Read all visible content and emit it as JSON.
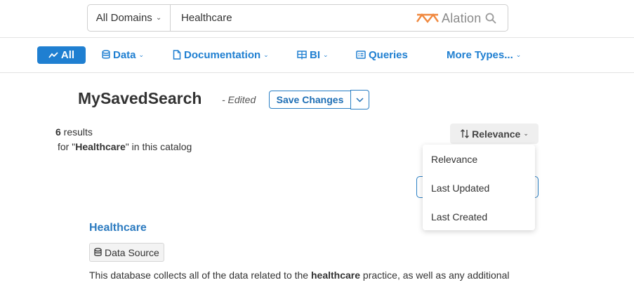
{
  "search": {
    "domain_label": "All Domains",
    "query": "Healthcare",
    "brand_name": "Alation"
  },
  "nav": {
    "all": "All",
    "data": "Data",
    "documentation": "Documentation",
    "bi": "BI",
    "queries": "Queries",
    "more_types": "More Types..."
  },
  "saved_search": {
    "title": "MySavedSearch",
    "edited": "- Edited",
    "save_label": "Save Changes"
  },
  "results": {
    "count": "6",
    "count_suffix": " results",
    "for_prefix": "for \"",
    "query": "Healthcare",
    "for_suffix": "\" in this catalog"
  },
  "sort": {
    "selected": "Relevance",
    "options": [
      "Relevance",
      "Last Updated",
      "Last Created"
    ]
  },
  "result_item": {
    "title": "Healthcare",
    "type": "Data Source",
    "desc_before": "This database collects all of the data related to the ",
    "desc_bold": "healthcare",
    "desc_after": " practice, as well as any additional"
  },
  "colors": {
    "accent": "#1f7fd1",
    "brand_orange": "#f0883e"
  },
  "icons": {
    "search": "search-icon",
    "brand": "alation-logo-icon",
    "all": "trend-icon",
    "data": "database-icon",
    "documentation": "document-icon",
    "bi": "bi-chart-icon",
    "queries": "query-icon",
    "sort": "sort-arrows-icon"
  }
}
